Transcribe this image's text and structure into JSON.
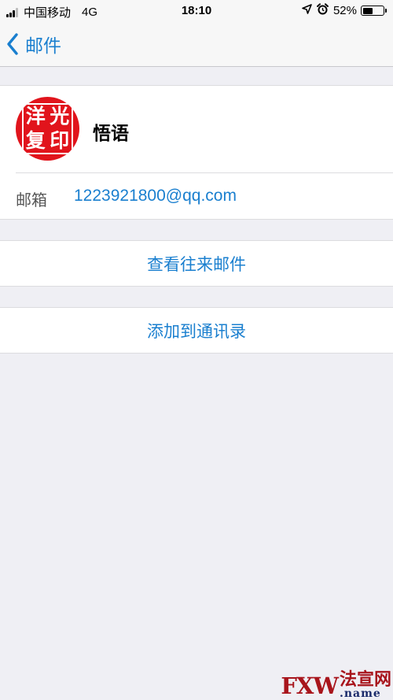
{
  "status_bar": {
    "carrier": "中国移动",
    "network": "4G",
    "time": "18:10",
    "battery_percent": "52%",
    "battery_level": 0.52
  },
  "nav": {
    "back_label": "邮件",
    "accent_color": "#1a7fcf"
  },
  "contact": {
    "avatar_chars": [
      "洋",
      "光",
      "复",
      "印"
    ],
    "avatar_color": "#e1141c",
    "name": "悟语",
    "email_label": "邮箱",
    "email": "1223921800@qq.com"
  },
  "actions": {
    "view_mail": "查看往来邮件",
    "add_contact": "添加到通讯录"
  },
  "watermark": {
    "left": "FXW",
    "cn": "法宣网",
    "sub": ".name"
  }
}
